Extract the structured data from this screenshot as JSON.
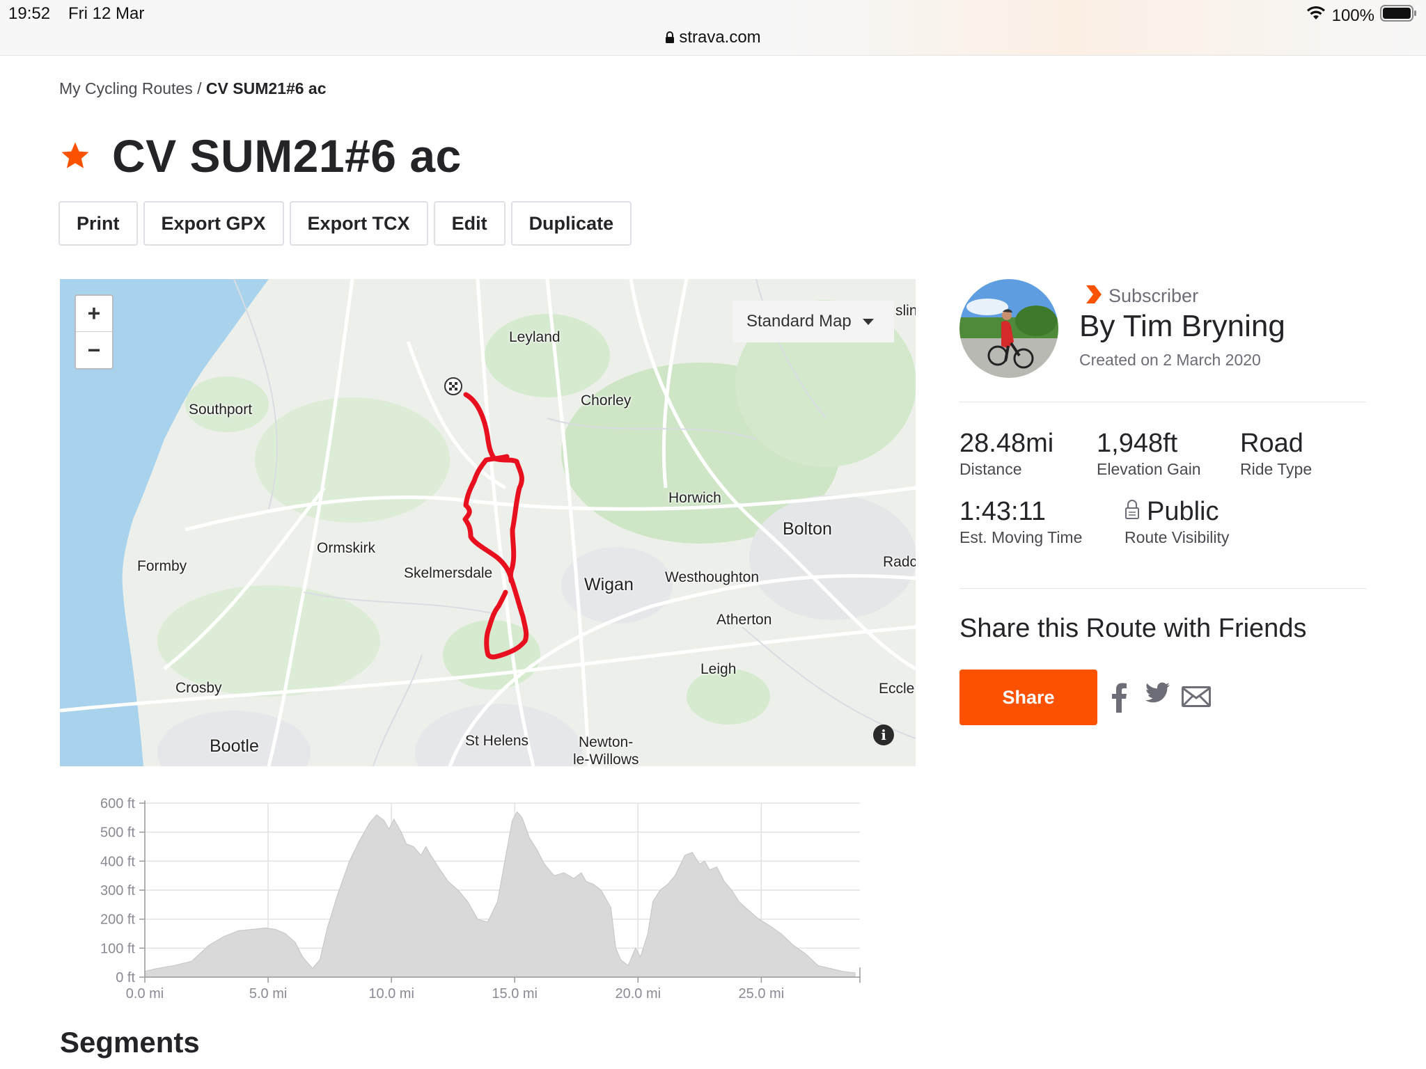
{
  "status_bar": {
    "time": "19:52",
    "date": "Fri 12 Mar",
    "battery": "100%",
    "url": "strava.com"
  },
  "breadcrumb": {
    "parent": "My Cycling Routes",
    "separator": "/",
    "current": "CV SUM21#6 ac"
  },
  "route": {
    "title": "CV SUM21#6 ac",
    "starred": true
  },
  "actions": {
    "print": "Print",
    "export_gpx": "Export GPX",
    "export_tcx": "Export TCX",
    "edit": "Edit",
    "duplicate": "Duplicate"
  },
  "map": {
    "zoom_in": "+",
    "zoom_out": "−",
    "map_type": "Standard Map",
    "info": "i",
    "places": {
      "leyland": "Leyland",
      "chorley": "Chorley",
      "southport": "Southport",
      "horwich": "Horwich",
      "bolton": "Bolton",
      "ormskirk": "Ormskirk",
      "formby": "Formby",
      "skelmersdale": "Skelmersdale",
      "wigan": "Wigan",
      "westhoughton": "Westhoughton",
      "radcliffe_partial": "Radc",
      "atherton": "Atherton",
      "leigh": "Leigh",
      "crosby": "Crosby",
      "eccles_partial": "Eccle",
      "bootle": "Bootle",
      "st_helens": "St Helens",
      "newton_line1": "Newton-",
      "newton_line2": "le-Willows",
      "edge_partial": "slin"
    },
    "route_color": "#e8101f"
  },
  "athlete": {
    "badge": "Subscriber",
    "name": "By Tim Bryning",
    "created": "Created on 2 March 2020"
  },
  "stats": {
    "distance": {
      "value": "28.48mi",
      "label": "Distance"
    },
    "elevation": {
      "value": "1,948ft",
      "label": "Elevation Gain"
    },
    "ride_type": {
      "value": "Road",
      "label": "Ride Type"
    },
    "moving_time": {
      "value": "1:43:11",
      "label": "Est. Moving Time"
    },
    "visibility": {
      "value": "Public",
      "label": "Route Visibility"
    }
  },
  "share": {
    "title": "Share this Route with Friends",
    "button": "Share"
  },
  "chart_data": {
    "type": "area",
    "title": "",
    "xlabel": "",
    "ylabel": "",
    "xlim": [
      0,
      29
    ],
    "ylim": [
      0,
      600
    ],
    "x_ticks": [
      "0.0 mi",
      "5.0 mi",
      "10.0 mi",
      "15.0 mi",
      "20.0 mi",
      "25.0 mi"
    ],
    "x_tick_values": [
      0,
      5,
      10,
      15,
      20,
      25
    ],
    "y_ticks": [
      "0 ft",
      "100 ft",
      "200 ft",
      "300 ft",
      "400 ft",
      "500 ft",
      "600 ft"
    ],
    "y_tick_values": [
      0,
      100,
      200,
      300,
      400,
      500,
      600
    ],
    "grid": true,
    "fill_color": "#d9d9d9",
    "series": [
      {
        "x": [
          0,
          0.5,
          1.2,
          1.9,
          2.6,
          3.2,
          3.8,
          4.4,
          4.9,
          5.3,
          5.7,
          6.1,
          6.4,
          6.8,
          7.1,
          7.4,
          7.8,
          8.3,
          8.7,
          9.1,
          9.4,
          9.7,
          9.9,
          10.1,
          10.4,
          10.6,
          10.9,
          11.2,
          11.4,
          11.6,
          11.9,
          12.3,
          12.7,
          13.1,
          13.5,
          13.9,
          14.3,
          14.6,
          14.9,
          15.1,
          15.3,
          15.6,
          15.9,
          16.2,
          16.6,
          17.0,
          17.4,
          17.7,
          17.9,
          18.2,
          18.5,
          18.9,
          19.1,
          19.3,
          19.6,
          19.9,
          20.1,
          20.4,
          20.6,
          20.9,
          21.2,
          21.5,
          21.9,
          22.2,
          22.5,
          22.7,
          22.9,
          23.2,
          23.5,
          23.8,
          24.1,
          24.5,
          24.9,
          25.3,
          25.8,
          26.3,
          26.8,
          27.3,
          27.8,
          28.3,
          28.8
        ],
        "y": [
          20,
          30,
          40,
          55,
          110,
          140,
          160,
          165,
          170,
          165,
          150,
          120,
          70,
          30,
          60,
          170,
          280,
          400,
          470,
          530,
          560,
          540,
          510,
          545,
          500,
          460,
          450,
          420,
          450,
          420,
          380,
          330,
          300,
          260,
          200,
          190,
          260,
          400,
          540,
          570,
          550,
          480,
          440,
          390,
          350,
          360,
          340,
          360,
          330,
          320,
          300,
          240,
          100,
          60,
          40,
          100,
          70,
          150,
          260,
          300,
          320,
          350,
          420,
          430,
          390,
          400,
          370,
          380,
          330,
          300,
          260,
          230,
          200,
          180,
          150,
          110,
          80,
          40,
          30,
          20,
          15
        ]
      }
    ]
  }
}
